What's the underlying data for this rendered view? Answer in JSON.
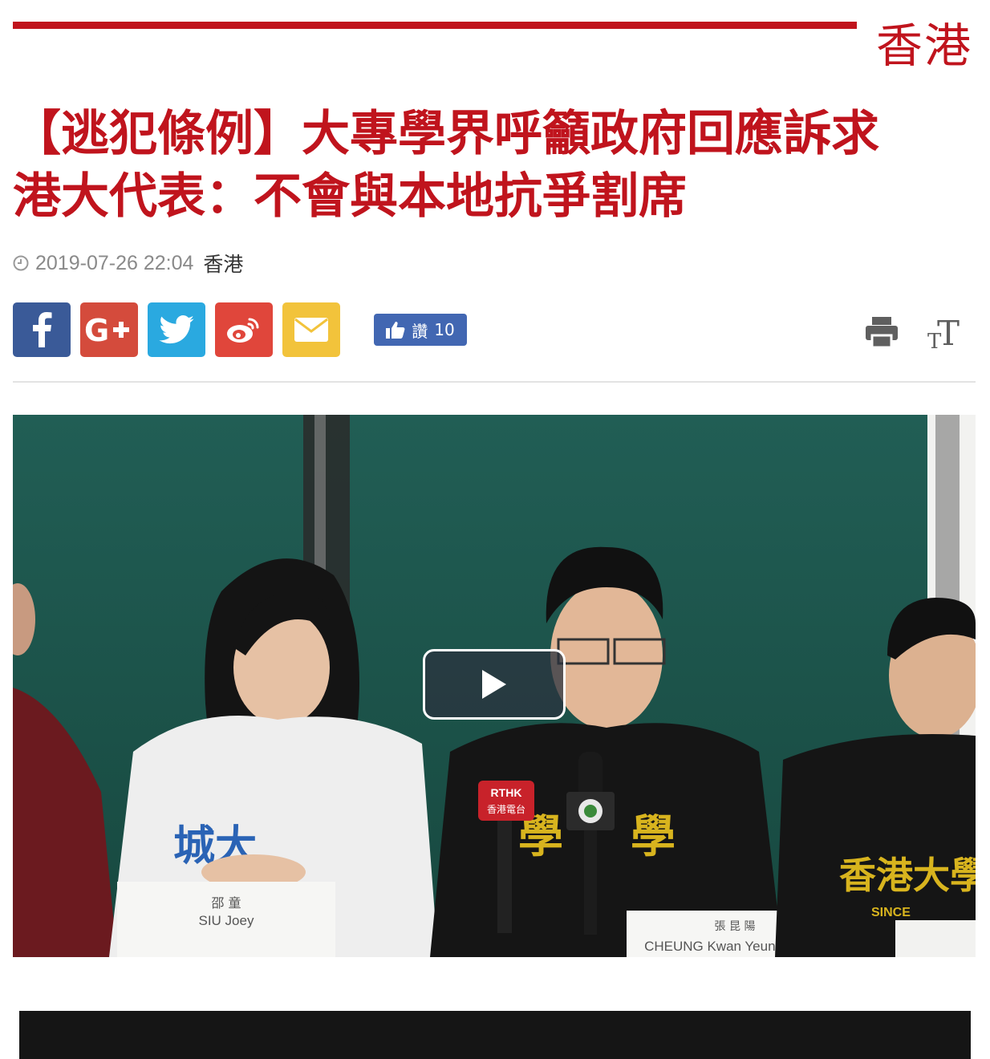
{
  "section": {
    "label": "香港"
  },
  "article": {
    "title_line1": "【逃犯條例】大專學界呼籲政府回應訴求",
    "title_line2": "港大代表：不會與本地抗爭割席",
    "datetime": "2019-07-26 22:04",
    "section": "香港"
  },
  "share": {
    "buttons": [
      {
        "name": "facebook",
        "icon": "facebook-icon",
        "color": "#3a5a98"
      },
      {
        "name": "google-plus",
        "icon": "google-plus-icon",
        "color": "#d44b3c"
      },
      {
        "name": "twitter",
        "icon": "twitter-icon",
        "color": "#2aa9e0"
      },
      {
        "name": "weibo",
        "icon": "weibo-icon",
        "color": "#e0463b"
      },
      {
        "name": "email",
        "icon": "envelope-icon",
        "color": "#f2c33b"
      }
    ],
    "like_label": "讚",
    "like_count": "10"
  },
  "tools": {
    "print_icon": "print-icon",
    "font_size_icon": "font-size-icon"
  },
  "video": {
    "play_icon": "play-icon",
    "nameplate_left_cn": "邵 童",
    "nameplate_left_en": "SIU Joey",
    "nameplate_right_cn": "張 昆 陽",
    "nameplate_right_en": "CHEUNG Kwan Yeung Sunny",
    "mic_label_rthk": "RTHK",
    "mic_label_rthk_cn": "香港電台",
    "shirt_text_right": "香港大學",
    "shirt_text_center": "學",
    "shirt_text_left": "城大",
    "shirt_since": "SINCE"
  },
  "colors": {
    "brand_red": "#c0141d",
    "meta_gray": "#8a8a8a"
  }
}
